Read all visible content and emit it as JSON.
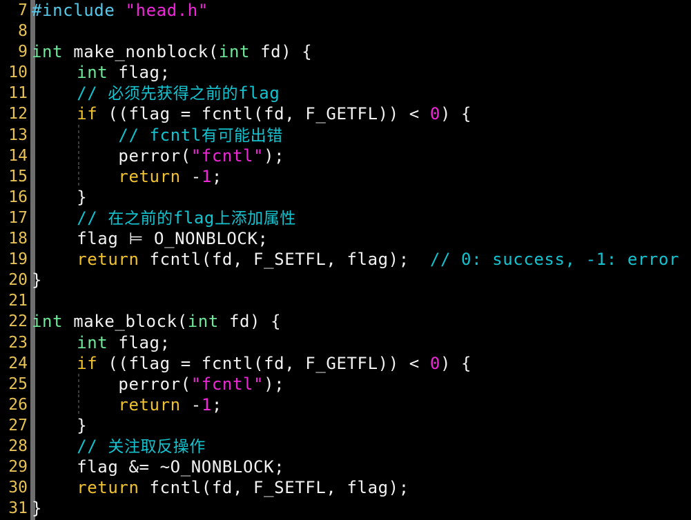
{
  "editor": {
    "language": "C",
    "theme": {
      "background": "#000000",
      "foreground": "#f2f2f2",
      "gutter_foreground": "#e8c252",
      "fold_bar": "#6e6e6e",
      "indent_guide": "#3a3a3a",
      "keyword": "#efc22e",
      "type": "#6ee89a",
      "preprocessor": "#56c8e8",
      "string": "#ef27d8",
      "number": "#ef27d8",
      "comment": "#12c3d0"
    },
    "first_line_number": 7,
    "last_line_number": 31,
    "lines": [
      {
        "number": "7",
        "flush": true,
        "indent_guide": false,
        "tokens": [
          {
            "class": "t-pre",
            "text": "#include"
          },
          {
            "class": "t-plain",
            "text": " "
          },
          {
            "class": "t-str",
            "text": "\"head.h\""
          }
        ]
      },
      {
        "number": "8",
        "flush": false,
        "indent_guide": false,
        "tokens": []
      },
      {
        "number": "9",
        "flush": true,
        "indent_guide": false,
        "tokens": [
          {
            "class": "t-type",
            "text": "int"
          },
          {
            "class": "t-plain",
            "text": " make_nonblock("
          },
          {
            "class": "t-type",
            "text": "int"
          },
          {
            "class": "t-plain",
            "text": " fd) {"
          }
        ]
      },
      {
        "number": "10",
        "flush": false,
        "indent_guide": false,
        "tokens": [
          {
            "class": "t-plain",
            "text": "    "
          },
          {
            "class": "t-type",
            "text": "int"
          },
          {
            "class": "t-plain",
            "text": " flag;"
          }
        ]
      },
      {
        "number": "11",
        "flush": false,
        "indent_guide": false,
        "tokens": [
          {
            "class": "t-cmt",
            "text": "    // "
          },
          {
            "class": "t-cmt-cjk",
            "text": "必须先获得之前的"
          },
          {
            "class": "t-cmt",
            "text": "flag"
          }
        ]
      },
      {
        "number": "12",
        "flush": false,
        "indent_guide": false,
        "tokens": [
          {
            "class": "t-plain",
            "text": "    "
          },
          {
            "class": "t-kw",
            "text": "if"
          },
          {
            "class": "t-plain",
            "text": " ((flag = fcntl(fd, F_GETFL)) < "
          },
          {
            "class": "t-num",
            "text": "0"
          },
          {
            "class": "t-plain",
            "text": ") {"
          }
        ]
      },
      {
        "number": "13",
        "flush": false,
        "indent_guide": true,
        "tokens": [
          {
            "class": "t-cmt",
            "text": "        // fcntl"
          },
          {
            "class": "t-cmt-cjk",
            "text": "有可能出错"
          }
        ]
      },
      {
        "number": "14",
        "flush": false,
        "indent_guide": true,
        "tokens": [
          {
            "class": "t-plain",
            "text": "        perror("
          },
          {
            "class": "t-str",
            "text": "\"fcntl\""
          },
          {
            "class": "t-plain",
            "text": ");"
          }
        ]
      },
      {
        "number": "15",
        "flush": false,
        "indent_guide": true,
        "tokens": [
          {
            "class": "t-plain",
            "text": "        "
          },
          {
            "class": "t-kw",
            "text": "return"
          },
          {
            "class": "t-plain",
            "text": " -"
          },
          {
            "class": "t-num",
            "text": "1"
          },
          {
            "class": "t-plain",
            "text": ";"
          }
        ]
      },
      {
        "number": "16",
        "flush": false,
        "indent_guide": false,
        "tokens": [
          {
            "class": "t-plain",
            "text": "    }"
          }
        ]
      },
      {
        "number": "17",
        "flush": false,
        "indent_guide": false,
        "tokens": [
          {
            "class": "t-cmt",
            "text": "    // "
          },
          {
            "class": "t-cmt-cjk",
            "text": "在之前的"
          },
          {
            "class": "t-cmt",
            "text": "flag"
          },
          {
            "class": "t-cmt-cjk",
            "text": "上添加属性"
          }
        ]
      },
      {
        "number": "18",
        "flush": false,
        "indent_guide": false,
        "tokens": [
          {
            "class": "t-plain",
            "text": "    flag "
          },
          {
            "class": "t-op lig",
            "text": "⊨"
          },
          {
            "class": "t-plain",
            "text": " O_NONBLOCK;"
          }
        ]
      },
      {
        "number": "19",
        "flush": false,
        "indent_guide": false,
        "tokens": [
          {
            "class": "t-plain",
            "text": "    "
          },
          {
            "class": "t-kw",
            "text": "return"
          },
          {
            "class": "t-plain",
            "text": " fcntl(fd, F_SETFL, flag);  "
          },
          {
            "class": "t-cmt",
            "text": "// 0: success, -1: error"
          }
        ]
      },
      {
        "number": "20",
        "flush": true,
        "indent_guide": false,
        "tokens": [
          {
            "class": "t-plain",
            "text": "}"
          }
        ]
      },
      {
        "number": "21",
        "flush": false,
        "indent_guide": false,
        "tokens": []
      },
      {
        "number": "22",
        "flush": true,
        "indent_guide": false,
        "tokens": [
          {
            "class": "t-type",
            "text": "int"
          },
          {
            "class": "t-plain",
            "text": " make_block("
          },
          {
            "class": "t-type",
            "text": "int"
          },
          {
            "class": "t-plain",
            "text": " fd) {"
          }
        ]
      },
      {
        "number": "23",
        "flush": false,
        "indent_guide": false,
        "tokens": [
          {
            "class": "t-plain",
            "text": "    "
          },
          {
            "class": "t-type",
            "text": "int"
          },
          {
            "class": "t-plain",
            "text": " flag;"
          }
        ]
      },
      {
        "number": "24",
        "flush": false,
        "indent_guide": false,
        "tokens": [
          {
            "class": "t-plain",
            "text": "    "
          },
          {
            "class": "t-kw",
            "text": "if"
          },
          {
            "class": "t-plain",
            "text": " ((flag = fcntl(fd, F_GETFL)) < "
          },
          {
            "class": "t-num",
            "text": "0"
          },
          {
            "class": "t-plain",
            "text": ") {"
          }
        ]
      },
      {
        "number": "25",
        "flush": false,
        "indent_guide": true,
        "tokens": [
          {
            "class": "t-plain",
            "text": "        perror("
          },
          {
            "class": "t-str",
            "text": "\"fcntl\""
          },
          {
            "class": "t-plain",
            "text": ");"
          }
        ]
      },
      {
        "number": "26",
        "flush": false,
        "indent_guide": true,
        "tokens": [
          {
            "class": "t-plain",
            "text": "        "
          },
          {
            "class": "t-kw",
            "text": "return"
          },
          {
            "class": "t-plain",
            "text": " -"
          },
          {
            "class": "t-num",
            "text": "1"
          },
          {
            "class": "t-plain",
            "text": ";"
          }
        ]
      },
      {
        "number": "27",
        "flush": false,
        "indent_guide": false,
        "tokens": [
          {
            "class": "t-plain",
            "text": "    }"
          }
        ]
      },
      {
        "number": "28",
        "flush": false,
        "indent_guide": false,
        "tokens": [
          {
            "class": "t-cmt",
            "text": "    // "
          },
          {
            "class": "t-cmt-cjk",
            "text": "关注取反操作"
          }
        ]
      },
      {
        "number": "29",
        "flush": false,
        "indent_guide": false,
        "tokens": [
          {
            "class": "t-plain",
            "text": "    flag &= ~O_NONBLOCK;"
          }
        ]
      },
      {
        "number": "30",
        "flush": false,
        "indent_guide": false,
        "tokens": [
          {
            "class": "t-plain",
            "text": "    "
          },
          {
            "class": "t-kw",
            "text": "return"
          },
          {
            "class": "t-plain",
            "text": " fcntl(fd, F_SETFL, flag);"
          }
        ]
      },
      {
        "number": "31",
        "flush": true,
        "indent_guide": false,
        "tokens": [
          {
            "class": "t-plain",
            "text": "}"
          }
        ]
      }
    ]
  }
}
